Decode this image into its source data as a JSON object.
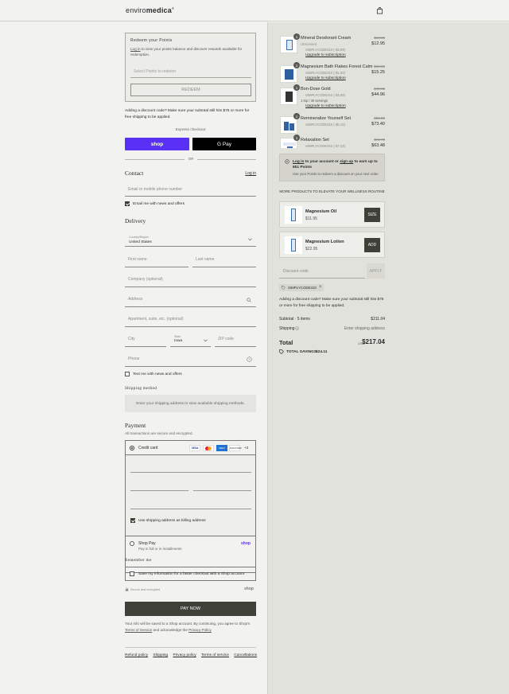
{
  "header": {
    "logo_prefix": "enviro",
    "logo_suffix": "medica",
    "logo_mark": "®"
  },
  "redeem": {
    "title": "Redeem your Points",
    "login_link": "Log in",
    "text": "to view your points balance and discover rewards available for redemption.",
    "select_placeholder": "Select Points to redeem",
    "button": "REDEEM"
  },
  "discount_note": "Adding a discount code? Make sure your subtotal still hits $75 or more for free shipping to be applied.",
  "express": {
    "label": "Express checkout",
    "shop_label": "shop",
    "gpay_label": "G Pay",
    "or_label": "OR"
  },
  "contact": {
    "title": "Contact",
    "login": "Log in",
    "email_placeholder": "Email or mobile phone number",
    "news_label": "Email me with news and offers"
  },
  "delivery": {
    "title": "Delivery",
    "country_label": "Country/Region",
    "country_value": "United States",
    "first_name": "First name",
    "last_name": "Last name",
    "company": "Company (optional)",
    "address": "Address",
    "apartment": "Apartment, suite, etc. (optional)",
    "city": "City",
    "state_label": "State",
    "state_value": "Iowa",
    "zip": "ZIP code",
    "phone": "Phone",
    "text_label": "Text me with news and offers"
  },
  "shipping": {
    "title": "Shipping method",
    "placeholder": "Enter your shipping address to view available shipping methods."
  },
  "payment": {
    "title": "Payment",
    "subtitle": "All transactions are secure and encrypted.",
    "credit_card": "Credit card",
    "card_more": "+3",
    "billing_label": "Use shipping address as billing address",
    "shop_pay": "Shop Pay",
    "shop_pay_sub": "Pay in full or in installments",
    "shop_pay_logo": "shop"
  },
  "remember": {
    "title": "Remember me",
    "label": "Save my information for a faster checkout with a Shop account",
    "secure": "Secure and encrypted",
    "shop": "shop"
  },
  "pay_button": "PAY NOW",
  "legal": {
    "text": "Your info will be saved to a Shop account. By continuing, you agree to Shop's",
    "terms": "Terms of Service",
    "and": "and acknowledge the",
    "privacy": "Privacy Policy"
  },
  "footer_links": [
    "Refund policy",
    "Shipping",
    "Privacy policy",
    "Terms of service",
    "Cancellations"
  ],
  "cart": {
    "items": [
      {
        "qty": "1",
        "name": "Mineral Deodorant Cream",
        "variant": "Unscented",
        "plan": "SIMPLYCODE310 (-$3.99)",
        "strike": "$16.95",
        "price": "$12.95",
        "upgrade": "Upgrade to subscription",
        "color": "#3a6fb0"
      },
      {
        "qty": "1",
        "name": "Magnesium Bath Flakes Forest Calm",
        "variant": "",
        "plan": "SIMPLYCODE310 (-$1.90)",
        "strike": "$19.95",
        "price": "$15.25",
        "upgrade": "Upgrade to subscription",
        "color": "#2c5fa0"
      },
      {
        "qty": "1",
        "name": "Bon-Dose Gold",
        "variant": "1 tsp / 30 servings",
        "plan": "SIMPLYCODE310 (-$4.99)",
        "strike": "$49.95",
        "price": "$44.96",
        "upgrade": "Upgrade to subscription",
        "color": "#333333"
      },
      {
        "qty": "1",
        "name": "Remineralize Yourself Set",
        "variant": "",
        "plan": "SIMPLYCODE310 (-$8.19)",
        "strike": "$81.59",
        "price": "$73.40",
        "upgrade": "",
        "color": "#2f63a6"
      },
      {
        "qty": "1",
        "name": "Relaxation Set",
        "variant": "",
        "plan": "SIMPLYCODE310 (-$7.23)",
        "strike": "$72.70",
        "price": "$63.48",
        "upgrade": "",
        "color": "#3a6fb0"
      }
    ],
    "points_box": {
      "login": "Log in",
      "to_your": "to your account or",
      "signup": "sign up",
      "rest": "to earn up to",
      "points": "651 Points",
      "sub": "Use your Points to redeem a discount on your next order."
    },
    "more_title": "MORE PRODUCTS TO ELEVATE YOUR WELLNESS ROUTINE",
    "upsell": [
      {
        "name": "Magnesium Oil",
        "price": "$11.95",
        "button": "SIZE"
      },
      {
        "name": "Magnesium Lotion",
        "price": "$22.95",
        "button": "ADD"
      }
    ],
    "discount_placeholder": "Discount code",
    "apply": "APPLY",
    "code_tag": "SIMPLYCODE310",
    "discount_note": "Adding a discount code? Make sure your subtotal still hits $75 or more for free shipping to be applied.",
    "subtotal_label": "Subtotal · 5 items",
    "subtotal_value": "$211.04",
    "shipping_label": "Shipping",
    "shipping_value": "Enter shipping address",
    "total_label": "Total",
    "currency": "USD",
    "total_value": "$217.04",
    "savings_label": "TOTAL SAVINGS",
    "savings_value": "$24.11"
  }
}
